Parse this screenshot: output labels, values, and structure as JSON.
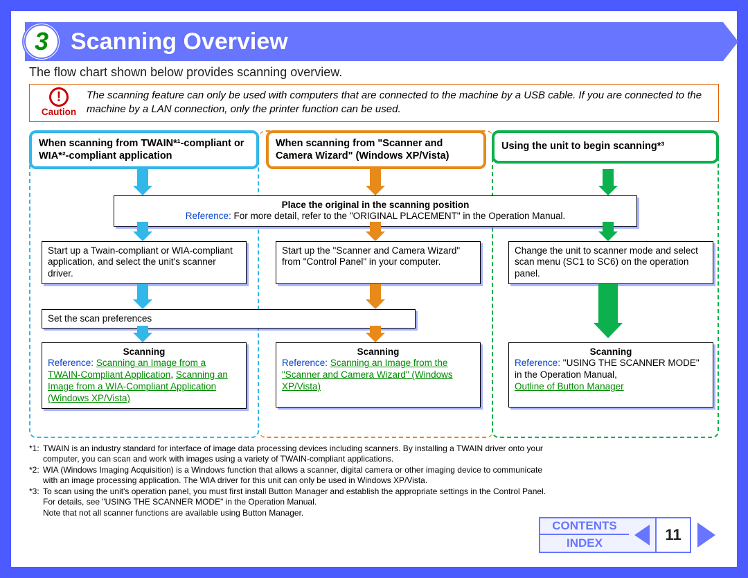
{
  "chapter_number": "3",
  "title": "Scanning Overview",
  "intro": "The flow chart shown below provides scanning overview.",
  "caution": {
    "label": "Caution",
    "mark": "!",
    "text": "The scanning feature can only be used with computers that are connected to the machine by a USB cable. If you are connected to the machine by a LAN connection, only the printer function can be used."
  },
  "columns": {
    "twain": {
      "heading": "When scanning from TWAIN*¹-compliant or WIA*²-compliant application"
    },
    "wizard": {
      "heading": "When scanning from \"Scanner and Camera Wizard\" (Windows XP/Vista)"
    },
    "unit": {
      "heading": "Using the unit to begin scanning*³"
    }
  },
  "boxes": {
    "placement": {
      "title": "Place the original in the scanning position",
      "ref_label": "Reference:",
      "ref_text": " For more detail, refer to the \"ORIGINAL PLACEMENT\" in the Operation Manual."
    },
    "step1a": "Start up a Twain-compliant or WIA-compliant application, and select the unit's scanner driver.",
    "step1b": "Start up the \"Scanner and Camera Wizard\" from \"Control Panel\" in your computer.",
    "step1c": "Change the unit to scanner mode and select scan menu (SC1 to SC6) on the operation panel.",
    "prefs": "Set the scan preferences",
    "scan1": {
      "title": "Scanning",
      "ref_label": "Reference:",
      "link1": "Scanning an Image from a TWAIN-Compliant Application",
      "sep": ", ",
      "link2": "Scanning an Image from a WIA-Compliant Application (Windows XP/Vista)"
    },
    "scan2": {
      "title": "Scanning",
      "ref_label": "Reference:",
      "link1": "Scanning an Image from the \"Scanner and Camera Wizard\" (Windows XP/Vista)"
    },
    "scan3": {
      "title": "Scanning",
      "ref_label": "Reference:",
      "text": " \"USING THE SCANNER MODE\" in the Operation Manual,",
      "link1": "Outline of Button Manager"
    }
  },
  "footnotes": {
    "f1_tag": "*1:",
    "f1": "TWAIN is an industry standard for interface of image data processing devices including scanners. By installing a TWAIN driver onto your computer, you can scan and work with images using a variety of TWAIN-compliant applications.",
    "f2_tag": "*2:",
    "f2": "WIA (Windows Imaging Acquisition) is a Windows function that allows a scanner, digital camera or other imaging device to communicate with an image processing application. The WIA driver for this unit can only be used in Windows XP/Vista.",
    "f3_tag": "*3:",
    "f3": "To scan using the unit's operation panel, you must first install Button Manager and establish the appropriate settings in the Control Panel. For details, see \"USING THE SCANNER MODE\" in the Operation Manual.",
    "note": "Note that not all scanner functions are available using Button Manager."
  },
  "nav": {
    "contents": "CONTENTS",
    "index": "INDEX",
    "page": "11"
  }
}
